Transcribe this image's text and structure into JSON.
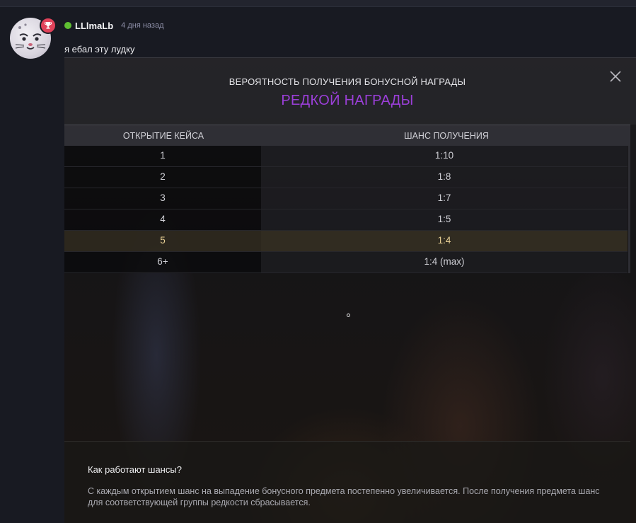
{
  "comment": {
    "username": "LLlmaLb",
    "timestamp": "4 дня назад",
    "text": "я ебал эту лудку",
    "online_color": "#5fbf32",
    "badge_icon": "trophy-icon"
  },
  "screenshot": {
    "title": "ВЕРОЯТНОСТЬ ПОЛУЧЕНИЯ БОНУСНОЙ НАГРАДЫ",
    "subtitle": "РЕДКОЙ НАГРАДЫ",
    "subtitle_color": "#9b3fd8",
    "close_icon": "close-icon",
    "table": {
      "headers": [
        "ОТКРЫТИЕ КЕЙСА",
        "ШАНС ПОЛУЧЕНИЯ"
      ],
      "rows": [
        {
          "open": "1",
          "chance": "1:10"
        },
        {
          "open": "2",
          "chance": "1:8"
        },
        {
          "open": "3",
          "chance": "1:7"
        },
        {
          "open": "4",
          "chance": "1:5"
        },
        {
          "open": "5",
          "chance": "1:4"
        },
        {
          "open": "6+",
          "chance": "1:4 (max)"
        }
      ],
      "highlighted_row": "5",
      "highlight_color": "#e7cf94"
    },
    "info": {
      "question": "Как работают шансы?",
      "answer": "С каждым открытием шанс на выпадение бонусного предмета постепенно увеличивается. После получения предмета шанс для соответствующей группы редкости сбрасывается."
    }
  }
}
